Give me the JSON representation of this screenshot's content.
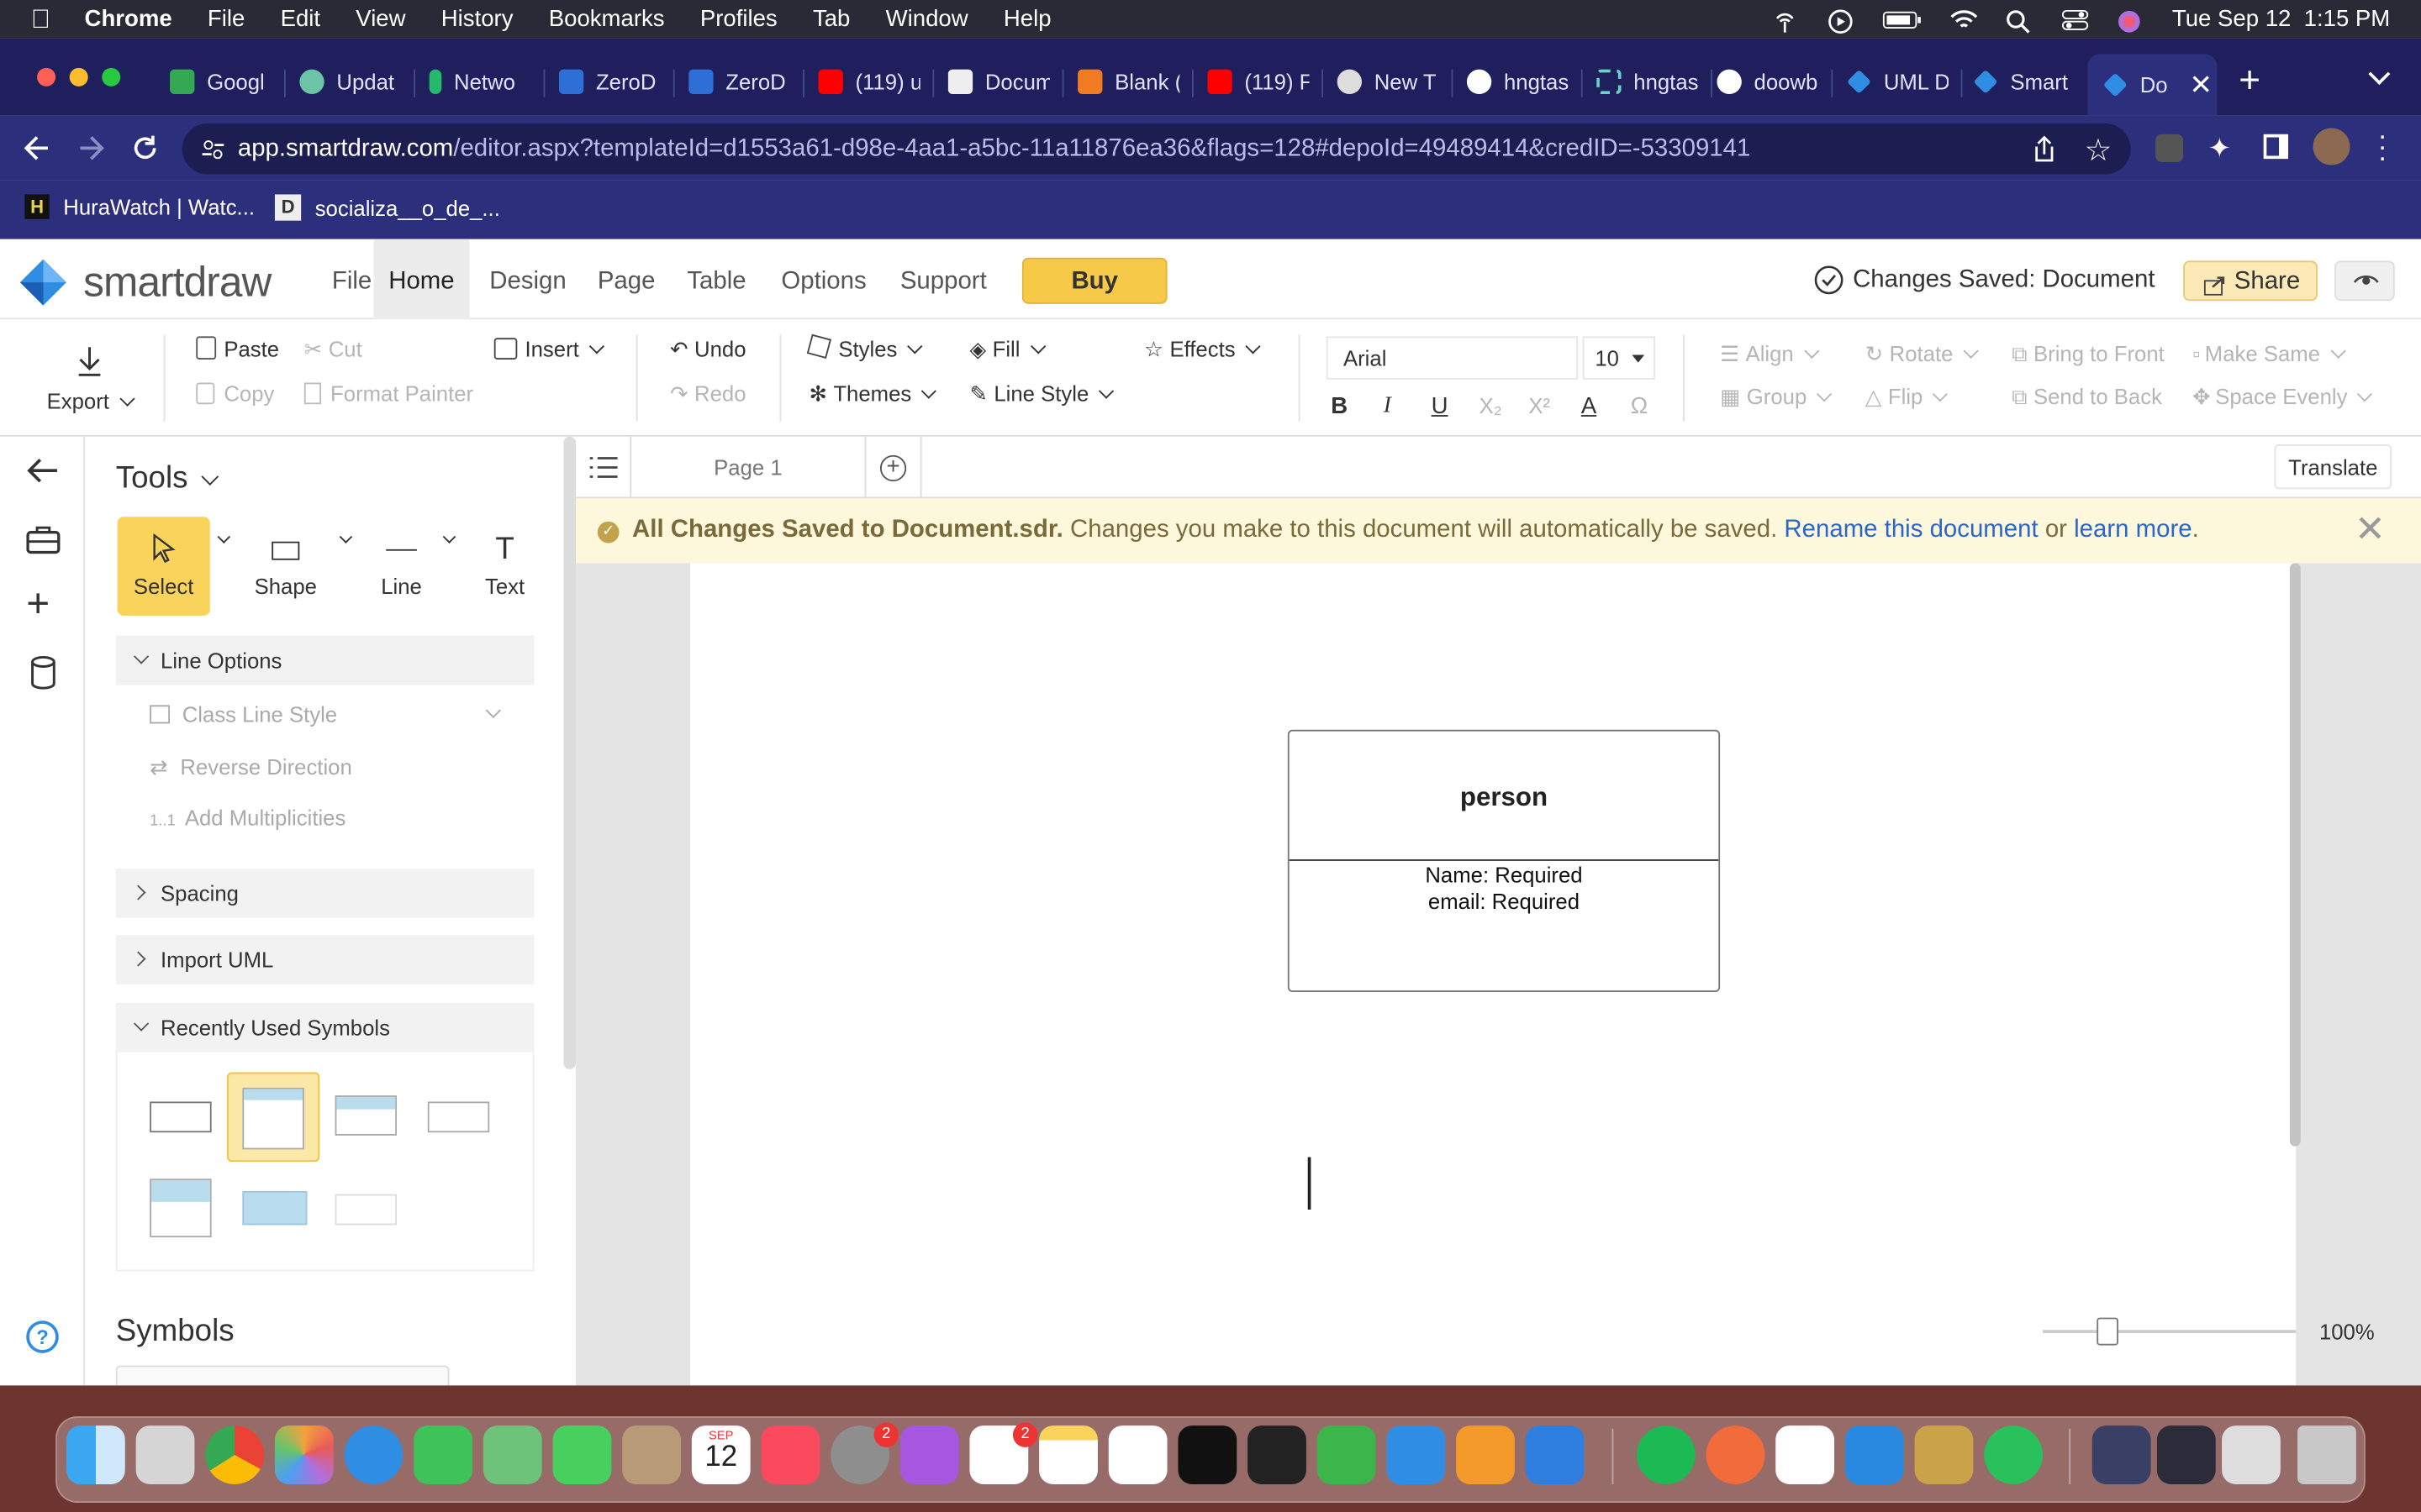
{
  "menubar": {
    "app": "Chrome",
    "items": [
      "File",
      "Edit",
      "View",
      "History",
      "Bookmarks",
      "Profiles",
      "Tab",
      "Window",
      "Help"
    ],
    "clock": "Tue Sep 12  1:15 PM"
  },
  "tabs": [
    {
      "label": "Googl",
      "color": "#34a853"
    },
    {
      "label": "Updat",
      "color": "#6bc4a6"
    },
    {
      "label": "Netwo",
      "color": "#25b96b"
    },
    {
      "label": "ZeroD",
      "color": "#2d6fd6"
    },
    {
      "label": "ZeroD",
      "color": "#2d6fd6"
    },
    {
      "label": "(119) u",
      "color": "#ff0000"
    },
    {
      "label": "Docum",
      "color": "#222222"
    },
    {
      "label": "Blank (",
      "color": "#f07b22"
    },
    {
      "label": "(119) F",
      "color": "#ff0000"
    },
    {
      "label": "New T",
      "color": "#dddddd"
    },
    {
      "label": "hngtas",
      "color": "#ffffff"
    },
    {
      "label": "hngtas",
      "color": "#6bd3c4"
    },
    {
      "label": "doowb",
      "color": "#ffffff"
    },
    {
      "label": "UML D",
      "color": "#2f8de4"
    },
    {
      "label": "Smart",
      "color": "#2f8de4"
    },
    {
      "label": "Do",
      "color": "#2f8de4",
      "active": true
    }
  ],
  "address": {
    "host": "app.smartdraw.com",
    "path": "/editor.aspx?templateId=d1553a61-d98e-4aa1-a5bc-11a11876ea36&flags=128#depoId=49489414&credID=-53309141"
  },
  "bookmarks": [
    {
      "label": "HuraWatch | Watc..."
    },
    {
      "label": "socializa__o_de_..."
    }
  ],
  "app": {
    "logo": "smartdraw",
    "nav": [
      "File",
      "Home",
      "Design",
      "Page",
      "Table",
      "Options",
      "Support"
    ],
    "active_nav": "Home",
    "buy": "Buy",
    "saved_status": "Changes Saved: Document",
    "share": "Share"
  },
  "ribbon": {
    "export": "Export",
    "paste": "Paste",
    "cut": "Cut",
    "copy": "Copy",
    "format_painter": "Format Painter",
    "insert": "Insert",
    "undo": "Undo",
    "redo": "Redo",
    "styles": "Styles",
    "themes": "Themes",
    "fill": "Fill",
    "line_style": "Line Style",
    "effects": "Effects",
    "font": "Arial",
    "font_size": "10",
    "align": "Align",
    "group": "Group",
    "rotate": "Rotate",
    "flip": "Flip",
    "bring_front": "Bring to Front",
    "send_back": "Send to Back",
    "make_same": "Make Same",
    "space_evenly": "Space Evenly",
    "format_glyphs": {
      "bold": "B",
      "italic": "I",
      "underline": "U",
      "sub": "X₂",
      "sup": "X²",
      "color": "A",
      "symbol": "Ω"
    }
  },
  "tools": {
    "title": "Tools",
    "buttons": [
      "Select",
      "Shape",
      "Line",
      "Text"
    ],
    "line_options": {
      "header": "Line Options",
      "items": [
        {
          "label": "Class Line Style"
        },
        {
          "label": "Reverse Direction"
        },
        {
          "label": "Add Multiplicities",
          "prefix": "1..1"
        }
      ]
    },
    "spacing": "Spacing",
    "import_uml": "Import UML",
    "recent": "Recently Used Symbols",
    "symbols": "Symbols"
  },
  "canvas": {
    "page_tab": "Page 1",
    "translate": "Translate",
    "banner": {
      "bold": "All Changes Saved to Document.sdr.",
      "text": "Changes you make to this document will automatically be saved.",
      "link1": "Rename this document",
      "or": "or",
      "link2": "learn more",
      "end": "."
    },
    "class": {
      "name": "person",
      "attributes": [
        "Name: Required",
        "email: Required"
      ]
    },
    "zoom": "100%",
    "zoom_fraction": 0.23
  },
  "dock": {
    "calendar": {
      "month": "SEP",
      "day": "12"
    },
    "badges": {
      "settings": "2",
      "reminders": "2"
    }
  }
}
